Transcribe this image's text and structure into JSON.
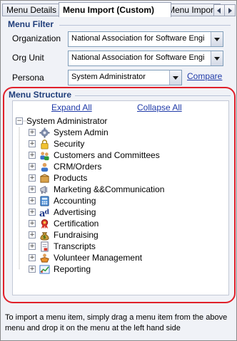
{
  "tabs": [
    {
      "label": "Menu Details",
      "active": false
    },
    {
      "label": "Menu Import (Custom)",
      "active": true
    },
    {
      "label": "Menu Import",
      "active": false
    }
  ],
  "filter": {
    "title": "Menu Filter",
    "organization_label": "Organization",
    "organization_value": "National Association for Software Engi",
    "org_unit_label": "Org Unit",
    "org_unit_value": "National Association for Software Engi",
    "persona_label": "Persona",
    "persona_value": "System Administrator",
    "compare_link": "Compare"
  },
  "structure": {
    "title": "Menu Structure",
    "expand_all": "Expand All",
    "collapse_all": "Collapse All",
    "root_label": "System Administrator",
    "items": [
      {
        "label": "System Admin",
        "icon": "gear-icon"
      },
      {
        "label": "Security",
        "icon": "lock-icon"
      },
      {
        "label": "Customers and Committees",
        "icon": "people-icon"
      },
      {
        "label": "CRM/Orders",
        "icon": "person-icon"
      },
      {
        "label": "Products",
        "icon": "box-icon"
      },
      {
        "label": "Marketing &&Communication",
        "icon": "megaphone-icon"
      },
      {
        "label": "Accounting",
        "icon": "calculator-icon"
      },
      {
        "label": "Advertising",
        "icon": "advertising-icon"
      },
      {
        "label": "Certification",
        "icon": "ribbon-icon"
      },
      {
        "label": "Fundraising",
        "icon": "money-bag-icon"
      },
      {
        "label": "Transcripts",
        "icon": "document-icon"
      },
      {
        "label": "Volunteer Management",
        "icon": "volunteer-icon"
      },
      {
        "label": "Reporting",
        "icon": "chart-icon"
      }
    ]
  },
  "help_text": "To import a menu item, simply drag a menu item from the above menu and drop it on the menu at the left hand side",
  "colors": {
    "section_title": "#1f3d7a",
    "link": "#1f3aa8",
    "highlight_border": "#e0202a"
  }
}
